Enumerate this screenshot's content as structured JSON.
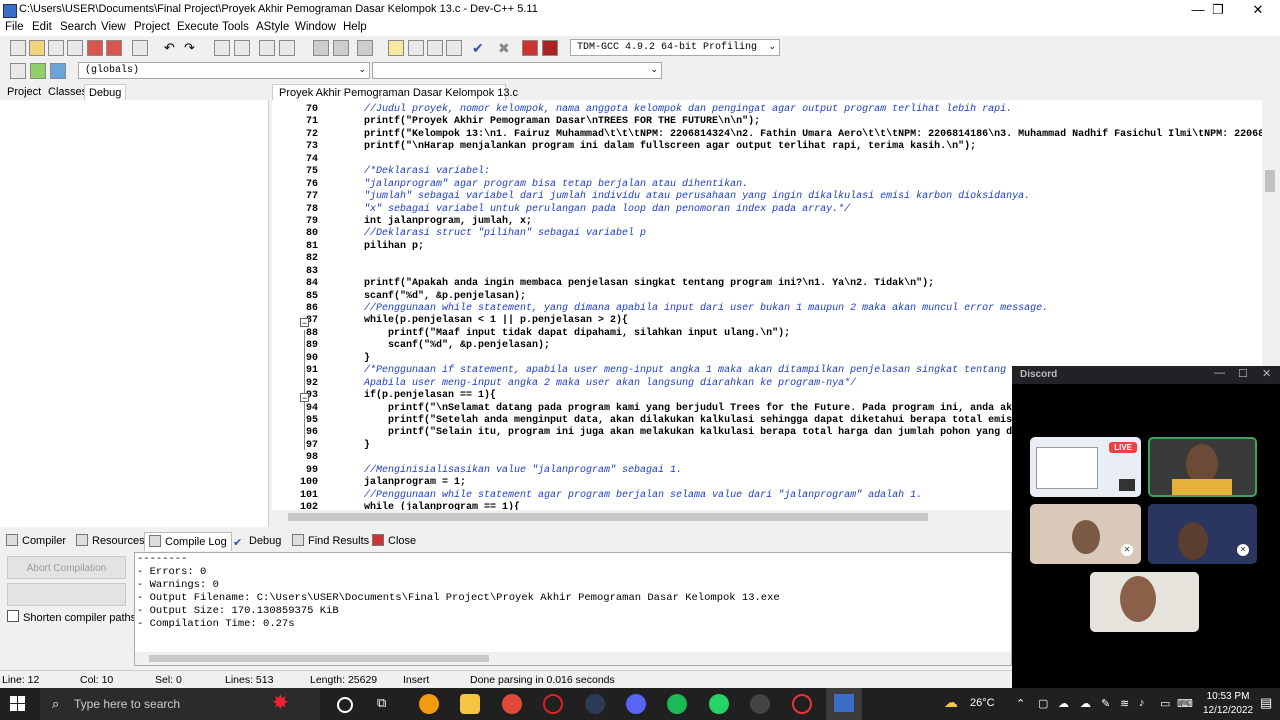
{
  "window": {
    "title": "C:\\Users\\USER\\Documents\\Final Project\\Proyek Akhir Pemograman Dasar Kelompok 13.c - Dev-C++ 5.11",
    "minimize": "—",
    "maximize": "❐",
    "close": "✕"
  },
  "menu": [
    "File",
    "Edit",
    "Search",
    "View",
    "Project",
    "Execute",
    "Tools",
    "AStyle",
    "Window",
    "Help"
  ],
  "toolbar": {
    "compiler_select": "TDM-GCC 4.9.2 64-bit Profiling",
    "globals_select": "(globals)"
  },
  "left_tabs": [
    "Project",
    "Classes",
    "Debug"
  ],
  "editor": {
    "tab_label": "Proyek Akhir Pemograman Dasar Kelompok 13.c",
    "line_numbers": [
      "70",
      "71",
      "72",
      "73",
      "74",
      "75",
      "76",
      "77",
      "78",
      "79",
      "80",
      "81",
      "82",
      "83",
      "84",
      "85",
      "86",
      "87",
      "88",
      "89",
      "90",
      "91",
      "92",
      "93",
      "94",
      "95",
      "96",
      "97",
      "98",
      "99",
      "100",
      "101",
      "102"
    ],
    "lines": [
      "    //Judul proyek, nomor kelompok, nama anggota kelompok dan pengingat agar output program terlihat lebih rapi.",
      "    printf(\"Proyek Akhir Pemograman Dasar\\nTREES FOR THE FUTURE\\n\\n\");",
      "    printf(\"Kelompok 13:\\n1. Fairuz Muhammad\\t\\t\\tNPM: 2206814324\\n2. Fathin Umara Aero\\t\\t\\tNPM: 2206814186\\n3. Muhammad Nadhif Fasichul Ilmi\\tNPM: 2206813416\\n4",
      "    printf(\"\\nHarap menjalankan program ini dalam fullscreen agar output terlihat rapi, terima kasih.\\n\");",
      "",
      "    /*Deklarasi variabel:",
      "    \"jalanprogram\" agar program bisa tetap berjalan atau dihentikan.",
      "    \"jumlah\" sebagai variabel dari jumlah individu atau perusahaan yang ingin dikalkulasi emisi karbon dioksidanya.",
      "    \"x\" sebagai variabel untuk perulangan pada loop dan penomoran index pada array.*/",
      "    int jalanprogram, jumlah, x;",
      "    //Deklarasi struct \"pilihan\" sebagai variabel p",
      "    pilihan p;",
      "",
      "",
      "    printf(\"Apakah anda ingin membaca penjelasan singkat tentang program ini?\\n1. Ya\\n2. Tidak\\n\");",
      "    scanf(\"%d\", &p.penjelasan);",
      "    //Penggunaan while statement, yang dimana apabila input dari user bukan 1 maupun 2 maka akan muncul error message.",
      "    while(p.penjelasan < 1 || p.penjelasan > 2){",
      "        printf(\"Maaf input tidak dapat dipahami, silahkan input ulang.\\n\");",
      "        scanf(\"%d\", &p.penjelasan);",
      "    }",
      "    /*Penggunaan if statement, apabila user meng-input angka 1 maka akan ditampilkan penjelasan singkat tentang program",
      "    Apabila user meng-input angka 2 maka user akan langsung diarahkan ke program-nya*/",
      "    if(p.penjelasan == 1){",
      "        printf(\"\\nSelamat datang pada program kami yang berjudul Trees for the Future. Pada program ini, anda akan dimi",
      "        printf(\"Setelah anda menginput data, akan dilakukan kalkulasi sehingga dapat diketahui berapa total emisi karbo",
      "        printf(\"Selain itu, program ini juga akan melakukan kalkulasi berapa total harga dan jumlah pohon yang dibutuhk",
      "    }",
      "",
      "    //Menginisialisasikan value \"jalanprogram\" sebagai 1.",
      "    jalanprogram = 1;",
      "    //Penggunaan while statement agar program berjalan selama value dari \"jalanprogram\" adalah 1.",
      "    while (jalanprogram == 1){"
    ]
  },
  "bottom_tabs": [
    "Compiler",
    "Resources",
    "Compile Log",
    "Debug",
    "Find Results",
    "Close"
  ],
  "compile_panel": {
    "abort_button": "Abort Compilation",
    "shorten_label": "Shorten compiler paths",
    "log": [
      "--------",
      "- Errors: 0",
      "- Warnings: 0",
      "- Output Filename: C:\\Users\\USER\\Documents\\Final Project\\Proyek Akhir Pemograman Dasar Kelompok 13.exe",
      "- Output Size: 170.130859375 KiB",
      "- Compilation Time: 0.27s"
    ]
  },
  "statusbar": {
    "line": "Line:  12",
    "col": "Col:  10",
    "sel": "Sel:  0",
    "lines": "Lines:  513",
    "length": "Length: 25629",
    "mode": "Insert",
    "message": "Done parsing in 0.016 seconds"
  },
  "discord": {
    "title": "Discord",
    "live_badge": "LIVE",
    "controls": [
      "—",
      "☐",
      "✕"
    ]
  },
  "taskbar": {
    "search_placeholder": "Type here to search",
    "weather": "26°C",
    "time": "10:53 PM",
    "date": "12/12/2022"
  },
  "colors": {
    "comment": "#1a3cc8",
    "string": "#1a1a9a",
    "discord_bg": "#202225",
    "live": "#ed4245",
    "taskbar": "#202020"
  }
}
